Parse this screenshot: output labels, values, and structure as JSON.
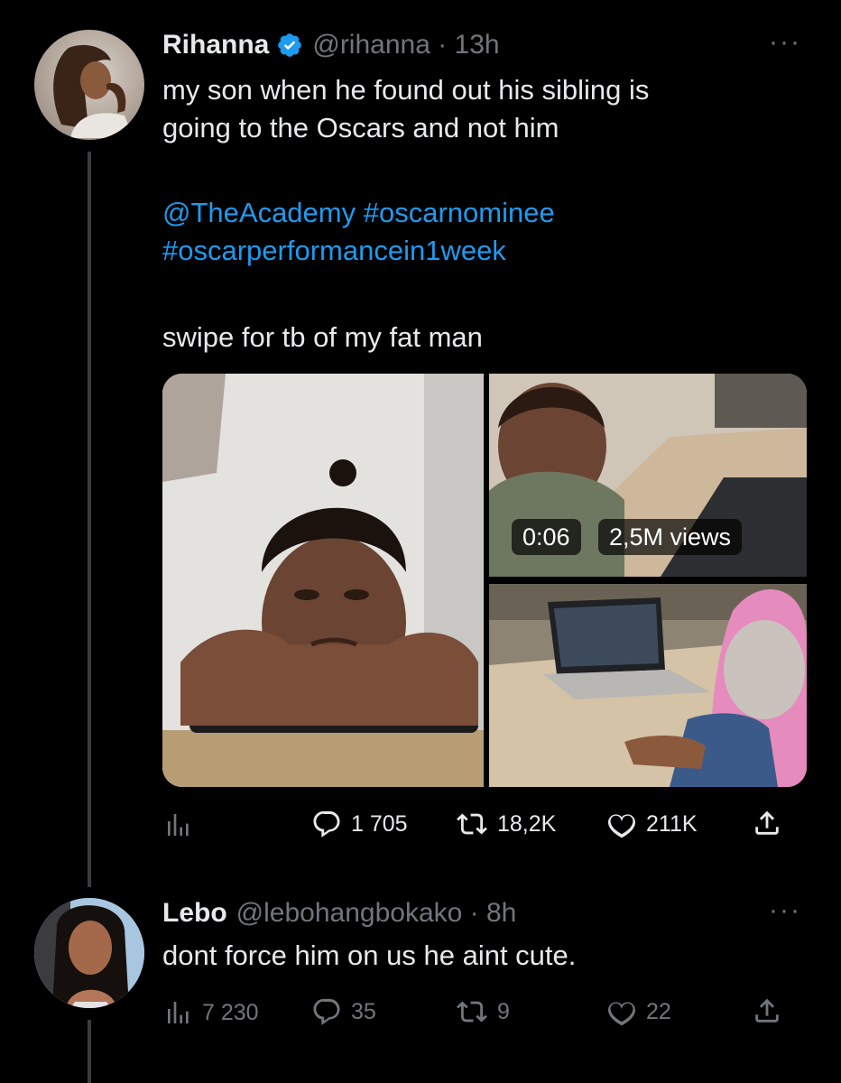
{
  "tweet": {
    "author_name": "Rihanna",
    "handle_time": "@rihanna · 13h",
    "text_line1": "my son when he found out his sibling is",
    "text_line2": "going to the Oscars and not him",
    "mention": "@TheAcademy",
    "hashtag1": "#oscarnominee",
    "hashtag2": "#oscarperformancein1week",
    "text_line3": "swipe for tb of my fat man",
    "video_duration": "0:06",
    "video_views": "2,5M views",
    "replies": "1 705",
    "retweets": "18,2K",
    "likes": "211K",
    "more": "···"
  },
  "reply": {
    "author_name": "Lebo",
    "handle_time": "@lebohangbokako · 8h",
    "text": "dont force him on us he aint cute.",
    "views": "7 230",
    "replies": "35",
    "retweets": "9",
    "likes": "22",
    "more": "···"
  },
  "colors": {
    "background": "#000000",
    "text": "#e7e9ea",
    "muted": "#71767b",
    "link": "#1d9bf0",
    "verified": "#1d9bf0"
  }
}
